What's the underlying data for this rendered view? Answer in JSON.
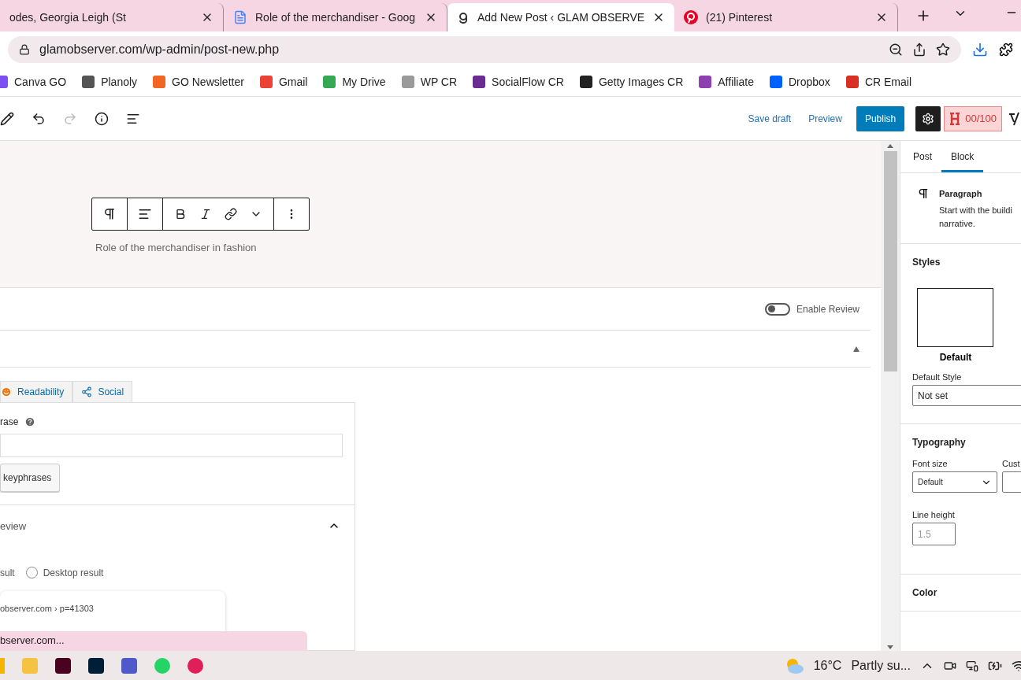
{
  "browser": {
    "tabs": [
      {
        "title": "odes, Georgia Leigh (St",
        "selected": false
      },
      {
        "title": "Role of the merchandiser - Goog",
        "selected": false
      },
      {
        "title": "Add New Post ‹ GLAM OBSERVE",
        "selected": true
      },
      {
        "title": "(21) Pinterest",
        "selected": false
      }
    ],
    "address": "glamobserver.com/wp-admin/post-new.php",
    "bookmarks": [
      {
        "label": "Canva GO",
        "color": "#7d4ef0"
      },
      {
        "label": "Planoly",
        "color": "#555555"
      },
      {
        "label": "GO Newsletter",
        "color": "#f26522"
      },
      {
        "label": "Gmail",
        "color": "#ea4335"
      },
      {
        "label": "My Drive",
        "color": "#34a853"
      },
      {
        "label": "WP CR",
        "color": "#9a9a9a"
      },
      {
        "label": "SocialFlow CR",
        "color": "#6a2c91"
      },
      {
        "label": "Getty Images CR",
        "color": "#222222"
      },
      {
        "label": "Affiliate",
        "color": "#8e3fb0"
      },
      {
        "label": "Dropbox",
        "color": "#0061fe"
      },
      {
        "label": "CR Email",
        "color": "#d93025"
      }
    ]
  },
  "editor_toolbar": {
    "undo_disabled": false,
    "redo_disabled": true,
    "save_draft": "Save draft",
    "preview": "Preview",
    "publish": "Publish",
    "score": "00/100"
  },
  "block_toolbar": {
    "caption": "Role of the merchandiser in fashion"
  },
  "review": {
    "label": "Enable Review",
    "on": false
  },
  "seo": {
    "tabs": [
      {
        "label": "Readability",
        "selected": false
      },
      {
        "label": "Social",
        "selected": false
      }
    ],
    "keyphrase_label": "rase",
    "keyphrase_button": "keyphrases",
    "preview_heading": "eview",
    "mobile_fragment": "sult",
    "desktop_option": {
      "label": "Desktop result",
      "selected": false
    },
    "snippet_url": "observer.com › p=41303"
  },
  "status_link": "bserver.com...",
  "sidebar": {
    "tabs": [
      {
        "label": "Post",
        "selected": false
      },
      {
        "label": "Block",
        "selected": true
      }
    ],
    "block_title": "Paragraph",
    "block_desc": [
      "Start with the buildi",
      "narrative."
    ],
    "styles_heading": "Styles",
    "style_option": "Default",
    "default_style_label": "Default Style",
    "default_style_value": "Not set",
    "typography_heading": "Typography",
    "font_size_label": "Font size",
    "font_size_value": "Default",
    "custom_label": "Cust",
    "line_height_label": "Line height",
    "line_height_placeholder": "1.5",
    "color_heading": "Color"
  },
  "taskbar": {
    "temperature": "16°C",
    "weather": "Partly su..."
  }
}
